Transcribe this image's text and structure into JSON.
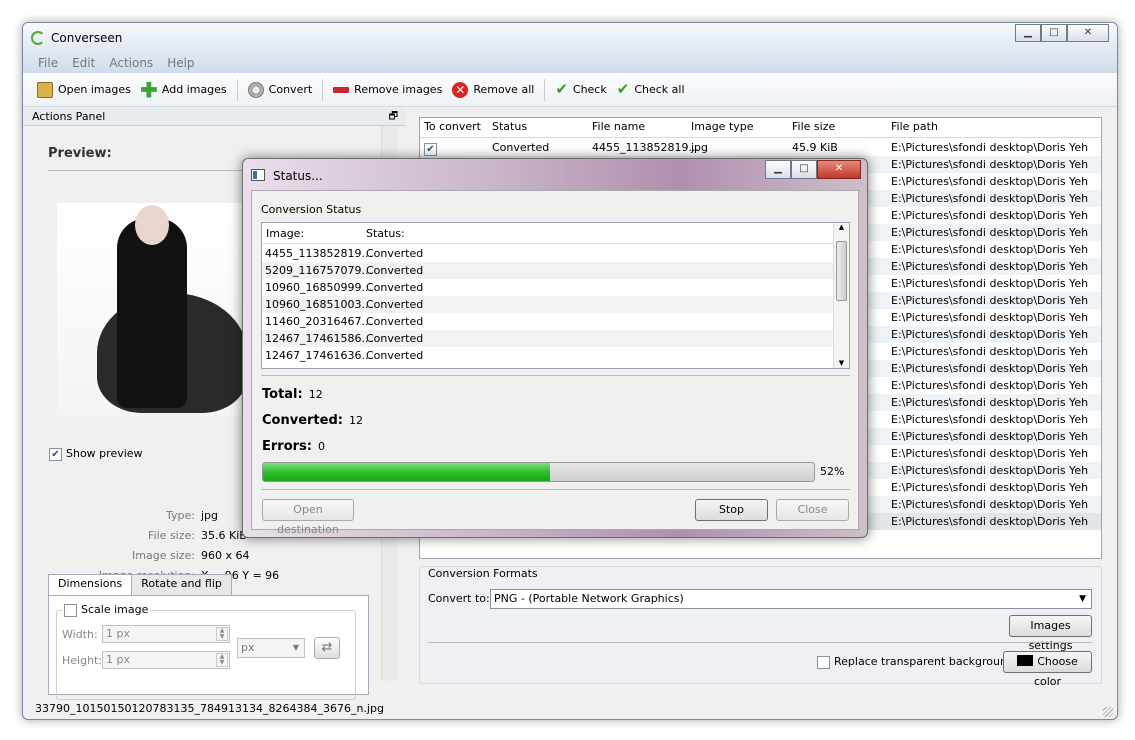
{
  "window": {
    "title": "Converseen"
  },
  "menu": [
    "File",
    "Edit",
    "Actions",
    "Help"
  ],
  "toolbar": {
    "open": "Open images",
    "add": "Add images",
    "convert": "Convert",
    "remove": "Remove images",
    "remove_all": "Remove all",
    "check": "Check",
    "check_all": "Check all"
  },
  "actions_panel": {
    "title": "Actions Panel",
    "preview": "Preview:",
    "show_preview": "Show preview",
    "type_label": "Type:",
    "type_value": "jpg",
    "filesize_label": "File size:",
    "filesize_value": "35.6 KiB",
    "imagesize_label": "Image size:",
    "imagesize_value": "960 x 64",
    "resolution_label": "Image resolution:",
    "resolution_value": "X = 96 Y = 96",
    "tabs": [
      "Dimensions",
      "Rotate and flip"
    ],
    "scale_image": "Scale image",
    "width_label": "Width:",
    "width_value": "1 px",
    "height_label": "Height:",
    "height_value": "1 px",
    "unit": "px"
  },
  "status_file": "33790_10150150120783135_784913134_8264384_3676_n.jpg",
  "table": {
    "headers": [
      "To convert",
      "Status",
      "File name",
      "Image type",
      "File size",
      "File path"
    ],
    "first_row": {
      "status": "Converted",
      "name": "4455_113852819...",
      "type": "jpg",
      "size": "45.9 KiB"
    },
    "path": "E:\\Pictures\\sfondi desktop\\Doris Yeh",
    "row_count": 23,
    "selected_row": 22
  },
  "formats": {
    "title": "Conversion Formats",
    "convert_to": "Convert to:",
    "format": "PNG - (Portable Network Graphics)",
    "images_settings": "Images settings",
    "replace_bg": "Replace transparent background",
    "choose_color": "Choose color"
  },
  "dialog": {
    "title": "Status...",
    "conversion_status": "Conversion Status",
    "col_image": "Image:",
    "col_status": "Status:",
    "rows": [
      {
        "image": "4455_113852819...",
        "status": "Converted"
      },
      {
        "image": "5209_116757079...",
        "status": "Converted"
      },
      {
        "image": "10960_16850999...",
        "status": "Converted"
      },
      {
        "image": "10960_16851003...",
        "status": "Converted"
      },
      {
        "image": "11460_20316467...",
        "status": "Converted"
      },
      {
        "image": "12467_17461586...",
        "status": "Converted"
      },
      {
        "image": "12467_17461636...",
        "status": "Converted"
      }
    ],
    "total_label": "Total:",
    "total": "12",
    "converted_label": "Converted:",
    "converted": "12",
    "errors_label": "Errors:",
    "errors": "0",
    "progress": 52,
    "progress_text": "52%",
    "open_destination": "Open destination",
    "stop": "Stop",
    "close": "Close"
  }
}
